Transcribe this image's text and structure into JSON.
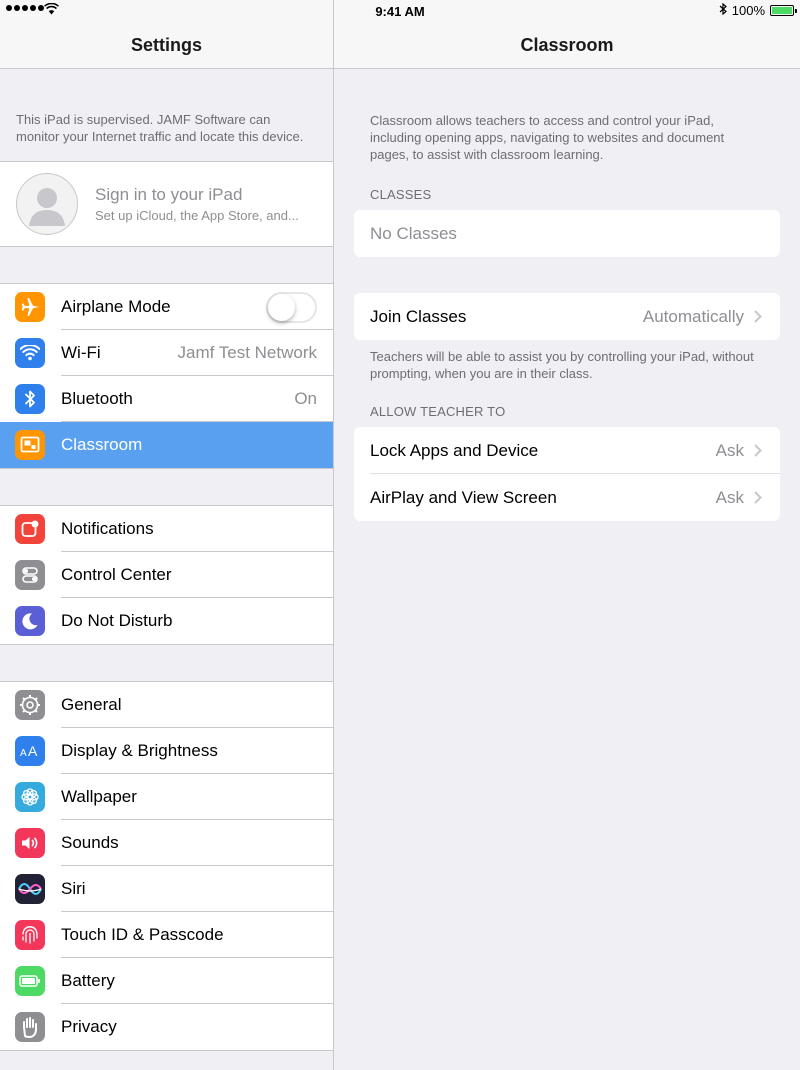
{
  "status_bar": {
    "time": "9:41 AM",
    "battery": "100%",
    "battery_level": 1.0
  },
  "master": {
    "title": "Settings",
    "supervision_note": "This iPad is supervised. JAMF Software can monitor your Internet traffic and locate this device.",
    "profile": {
      "title": "Sign in to your iPad",
      "subtitle": "Set up iCloud, the App Store, and..."
    },
    "group1": [
      {
        "label": "Airplane Mode",
        "icon": "airplane-icon",
        "color": "#ff9500",
        "toggle": false
      },
      {
        "label": "Wi-Fi",
        "value": "Jamf Test Network",
        "icon": "wifi-icon",
        "color": "#2f80ed"
      },
      {
        "label": "Bluetooth",
        "value": "On",
        "icon": "bluetooth-icon",
        "color": "#2f80ed"
      },
      {
        "label": "Classroom",
        "icon": "classroom-icon",
        "color": "#ff9500",
        "selected": true
      }
    ],
    "group2": [
      {
        "label": "Notifications",
        "icon": "notifications-icon",
        "color": "#f2443a"
      },
      {
        "label": "Control Center",
        "icon": "control-center-icon",
        "color": "#8e8e93"
      },
      {
        "label": "Do Not Disturb",
        "icon": "moon-icon",
        "color": "#5b5fd6"
      }
    ],
    "group3": [
      {
        "label": "General",
        "icon": "gear-icon",
        "color": "#8e8e93"
      },
      {
        "label": "Display & Brightness",
        "icon": "display-icon",
        "color": "#2f80ed"
      },
      {
        "label": "Wallpaper",
        "icon": "wallpaper-icon",
        "color": "#35aadc"
      },
      {
        "label": "Sounds",
        "icon": "sounds-icon",
        "color": "#f2375a"
      },
      {
        "label": "Siri",
        "icon": "siri-icon",
        "color": "#222236"
      },
      {
        "label": "Touch ID & Passcode",
        "icon": "fingerprint-icon",
        "color": "#f2375a"
      },
      {
        "label": "Battery",
        "icon": "battery-icon",
        "color": "#4cd964"
      },
      {
        "label": "Privacy",
        "icon": "hand-icon",
        "color": "#8e8e93"
      }
    ]
  },
  "detail": {
    "title": "Classroom",
    "intro": "Classroom allows teachers to access and control your iPad, including opening apps, navigating to websites and document pages, to assist with classroom learning.",
    "classes_header": "CLASSES",
    "no_classes": "No Classes",
    "join": {
      "label": "Join Classes",
      "value": "Automatically"
    },
    "join_note": "Teachers will be able to assist you by controlling your iPad, without prompting, when you are in their class.",
    "allow_header": "ALLOW TEACHER TO",
    "allow": [
      {
        "label": "Lock Apps and Device",
        "value": "Ask"
      },
      {
        "label": "AirPlay and View Screen",
        "value": "Ask"
      }
    ]
  }
}
